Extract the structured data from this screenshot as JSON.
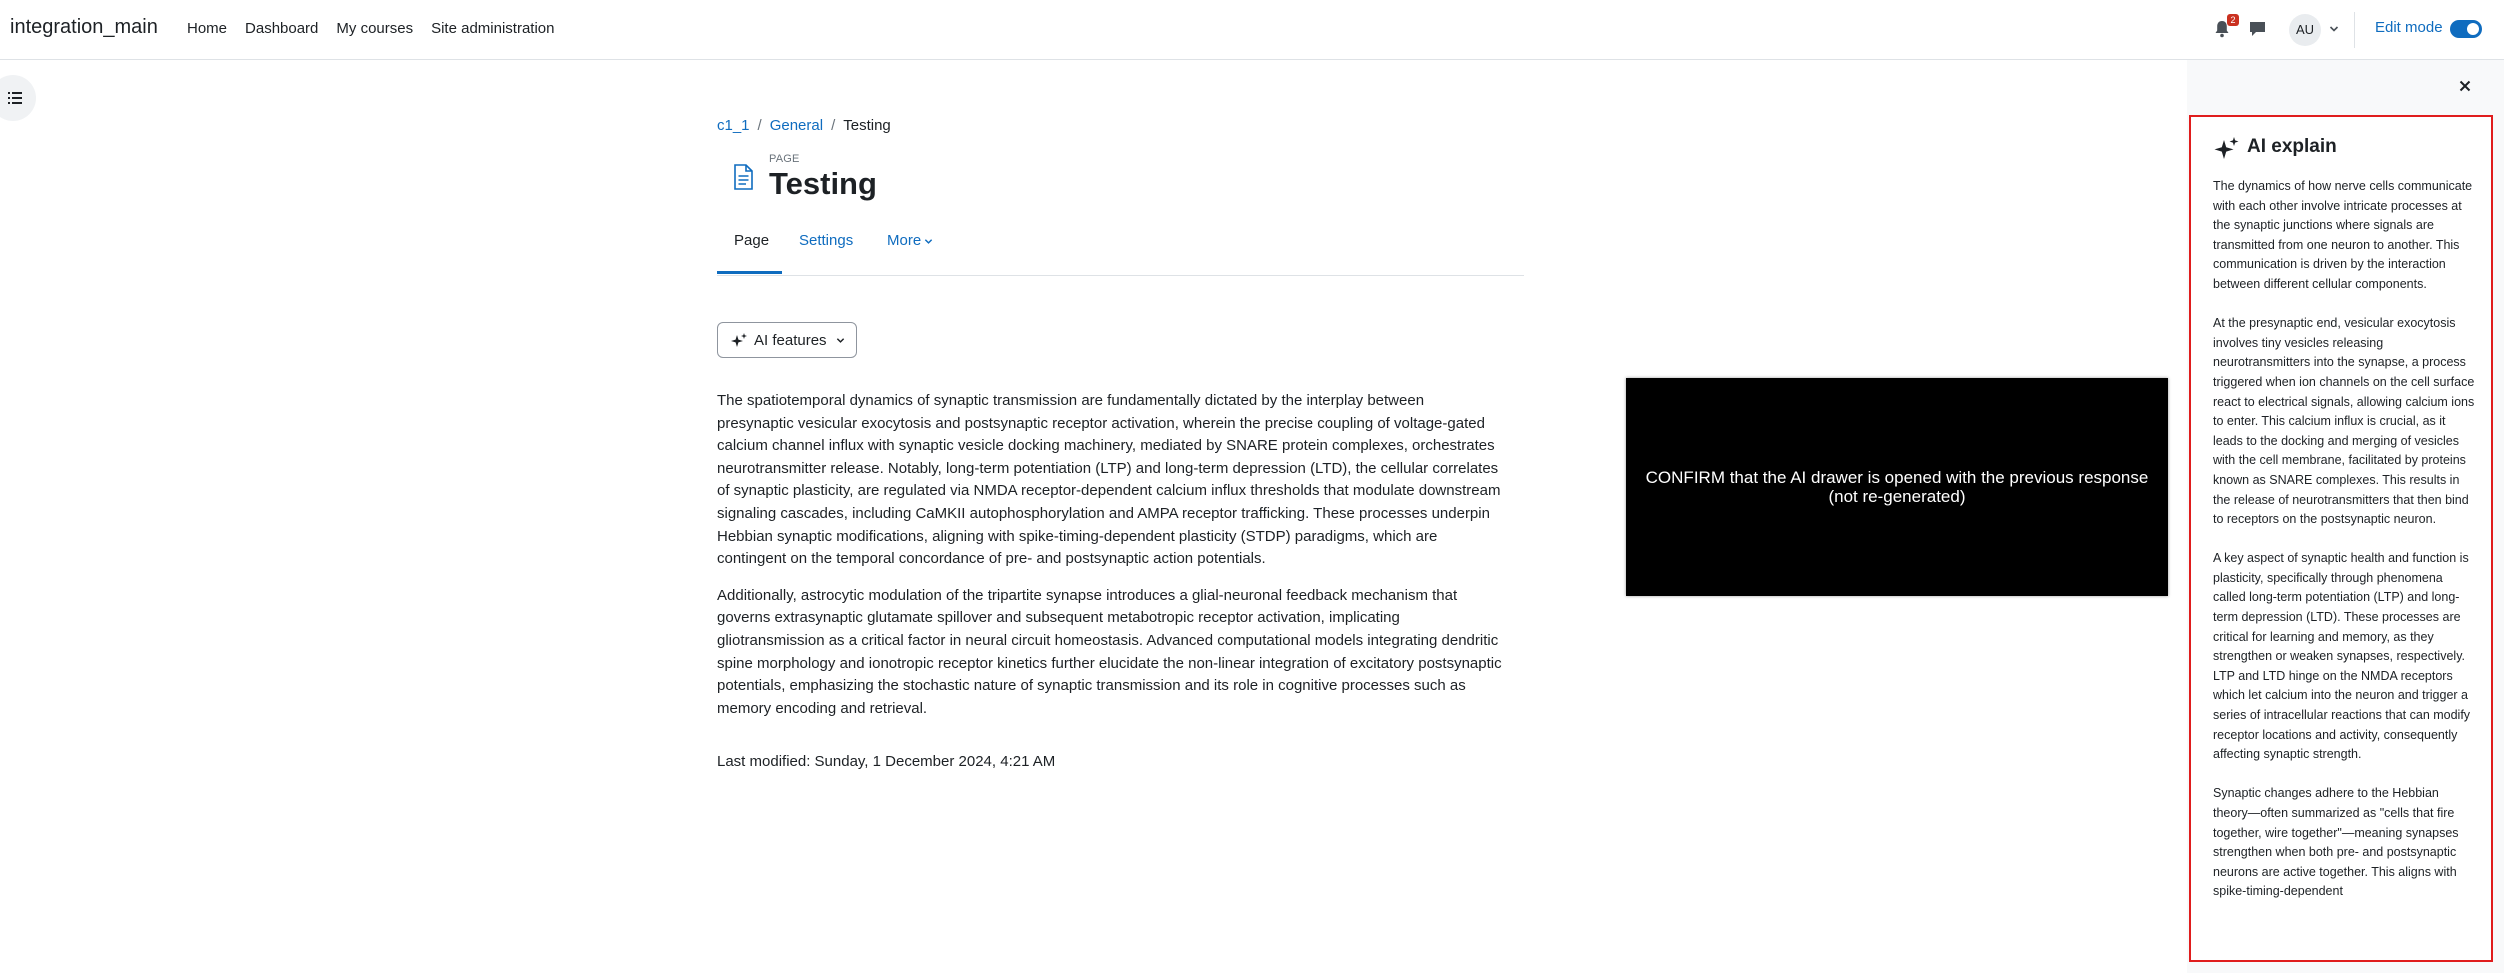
{
  "navbar": {
    "brand": "integration_main",
    "items": [
      "Home",
      "Dashboard",
      "My courses",
      "Site administration"
    ],
    "notification_count": "2",
    "avatar_initials": "AU",
    "edit_mode_label": "Edit mode",
    "edit_mode_on": true
  },
  "breadcrumb": {
    "course": "c1_1",
    "section": "General",
    "current": "Testing"
  },
  "page": {
    "type_label": "PAGE",
    "title": "Testing"
  },
  "tabs": {
    "page": "Page",
    "settings": "Settings",
    "more": "More"
  },
  "ai_button": {
    "label": "AI features"
  },
  "content": {
    "paragraph1": "The spatiotemporal dynamics of synaptic transmission are fundamentally dictated by the interplay between presynaptic vesicular exocytosis and postsynaptic receptor activation, wherein the precise coupling of voltage-gated calcium channel influx with synaptic vesicle docking machinery, mediated by SNARE protein complexes, orchestrates neurotransmitter release. Notably, long-term potentiation (LTP) and long-term depression (LTD), the cellular correlates of synaptic plasticity, are regulated via NMDA receptor-dependent calcium influx thresholds that modulate downstream signaling cascades, including CaMKII autophosphorylation and AMPA receptor trafficking. These processes underpin Hebbian synaptic modifications, aligning with spike-timing-dependent plasticity (STDP) paradigms, which are contingent on the temporal concordance of pre- and postsynaptic action potentials.",
    "paragraph2": "Additionally, astrocytic modulation of the tripartite synapse introduces a glial-neuronal feedback mechanism that governs extrasynaptic glutamate spillover and subsequent metabotropic receptor activation, implicating gliotransmission as a critical factor in neural circuit homeostasis. Advanced computational models integrating dendritic spine morphology and ionotropic receptor kinetics further elucidate the non-linear integration of excitatory postsynaptic potentials, emphasizing the stochastic nature of synaptic transmission and its role in cognitive processes such as memory encoding and retrieval.",
    "last_modified": "Last modified: Sunday, 1 December 2024, 4:21 AM"
  },
  "overlay": {
    "text": "CONFIRM that the AI drawer is opened with the previous response (not re-generated)"
  },
  "ai_drawer": {
    "title": "AI explain",
    "paragraphs": [
      "The dynamics of how nerve cells communicate with each other involve intricate processes at the synaptic junctions where signals are transmitted from one neuron to another. This communication is driven by the interaction between different cellular components.",
      "At the presynaptic end, vesicular exocytosis involves tiny vesicles releasing neurotransmitters into the synapse, a process triggered when ion channels on the cell surface react to electrical signals, allowing calcium ions to enter. This calcium influx is crucial, as it leads to the docking and merging of vesicles with the cell membrane, facilitated by proteins known as SNARE complexes. This results in the release of neurotransmitters that then bind to receptors on the postsynaptic neuron.",
      "A key aspect of synaptic health and function is plasticity, specifically through phenomena called long-term potentiation (LTP) and long-term depression (LTD). These processes are critical for learning and memory, as they strengthen or weaken synapses, respectively. LTP and LTD hinge on the NMDA receptors which let calcium into the neuron and trigger a series of intracellular reactions that can modify receptor locations and activity, consequently affecting synaptic strength.",
      "Synaptic changes adhere to the Hebbian theory—often summarized as \"cells that fire together, wire together\"—meaning synapses strengthen when both pre- and postsynaptic neurons are active together. This aligns with spike-timing-dependent"
    ]
  },
  "colors": {
    "link": "#0f6cbf",
    "highlight_border": "#e01d1d",
    "badge": "#ca3120"
  }
}
